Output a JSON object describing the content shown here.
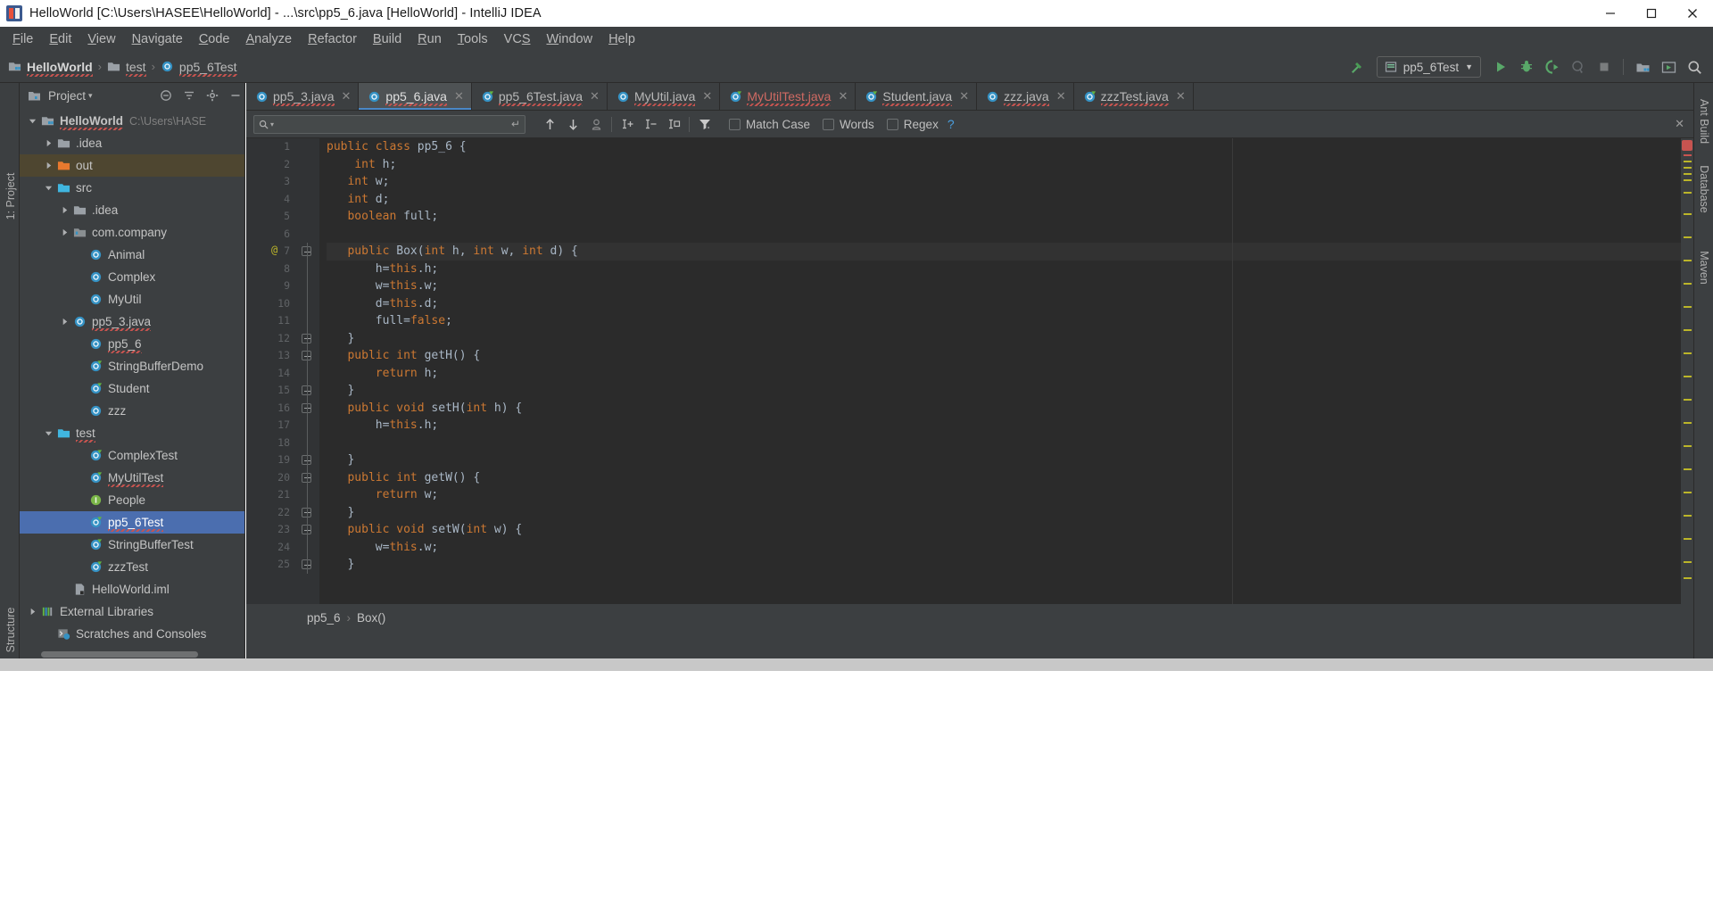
{
  "window": {
    "title": "HelloWorld [C:\\Users\\HASEE\\HelloWorld] - ...\\src\\pp5_6.java [HelloWorld] - IntelliJ IDEA",
    "app_icon": "intellij-idea-icon",
    "minimize_label": "Minimize",
    "maximize_label": "Maximize",
    "close_label": "Close"
  },
  "menubar": {
    "items": [
      {
        "label": "File",
        "mnemonic": "F"
      },
      {
        "label": "Edit",
        "mnemonic": "E"
      },
      {
        "label": "View",
        "mnemonic": "V"
      },
      {
        "label": "Navigate",
        "mnemonic": "N"
      },
      {
        "label": "Code",
        "mnemonic": "C"
      },
      {
        "label": "Analyze",
        "mnemonic": "A"
      },
      {
        "label": "Refactor",
        "mnemonic": "R"
      },
      {
        "label": "Build",
        "mnemonic": "B"
      },
      {
        "label": "Run",
        "mnemonic": "R"
      },
      {
        "label": "Tools",
        "mnemonic": "T"
      },
      {
        "label": "VCS",
        "mnemonic": "S"
      },
      {
        "label": "Window",
        "mnemonic": "W"
      },
      {
        "label": "Help",
        "mnemonic": "H"
      }
    ]
  },
  "navbar": {
    "breadcrumbs": [
      {
        "label": "HelloWorld",
        "icon": "module-icon"
      },
      {
        "label": "test",
        "icon": "folder-icon"
      },
      {
        "label": "pp5_6Test",
        "icon": "java-class-icon"
      }
    ],
    "separator": "›",
    "build_icon": "build-hammer-icon",
    "run_config": {
      "label": "pp5_6Test",
      "icon": "junit-config-icon",
      "chevron": "▼"
    },
    "toolbar_icons": [
      "run-icon",
      "debug-icon",
      "run-with-coverage-icon",
      "profile-icon",
      "stop-icon",
      "project-structure-icon",
      "update-icon",
      "search-everywhere-icon"
    ]
  },
  "tool_windows": {
    "left": [
      {
        "label": "1: Project"
      },
      {
        "label": "Structure"
      }
    ],
    "right": [
      {
        "label": "Ant Build"
      },
      {
        "label": "Database"
      },
      {
        "label": "Maven"
      }
    ]
  },
  "project_panel": {
    "title": "Project",
    "title_chevron": "▾",
    "header_icons": [
      "collapse-all-icon",
      "filter-icon",
      "settings-gear-icon",
      "hide-icon"
    ],
    "tree": [
      {
        "label": "HelloWorld",
        "sub": "C:\\Users\\HASE",
        "icon": "module-icon",
        "twisty": "down",
        "indent": 0,
        "bold": true,
        "state": "normal",
        "error": true
      },
      {
        "label": ".idea",
        "sub": "",
        "icon": "folder-icon",
        "twisty": "right",
        "indent": 1,
        "bold": false,
        "state": "normal",
        "error": false
      },
      {
        "label": "out",
        "sub": "",
        "icon": "folder-orange-icon",
        "twisty": "right",
        "indent": 1,
        "bold": false,
        "state": "highlight",
        "error": false
      },
      {
        "label": "src",
        "sub": "",
        "icon": "folder-source-icon",
        "twisty": "down",
        "indent": 1,
        "bold": false,
        "state": "normal",
        "error": false
      },
      {
        "label": ".idea",
        "sub": "",
        "icon": "folder-icon",
        "twisty": "right",
        "indent": 2,
        "bold": false,
        "state": "normal",
        "error": false
      },
      {
        "label": "com.company",
        "sub": "",
        "icon": "package-icon",
        "twisty": "right",
        "indent": 2,
        "bold": false,
        "state": "normal",
        "error": false
      },
      {
        "label": "Animal",
        "sub": "",
        "icon": "java-class-icon",
        "twisty": "none",
        "indent": 3,
        "bold": false,
        "state": "normal",
        "error": false
      },
      {
        "label": "Complex",
        "sub": "",
        "icon": "java-class-icon",
        "twisty": "none",
        "indent": 3,
        "bold": false,
        "state": "normal",
        "error": false
      },
      {
        "label": "MyUtil",
        "sub": "",
        "icon": "java-class-icon",
        "twisty": "none",
        "indent": 3,
        "bold": false,
        "state": "normal",
        "error": false
      },
      {
        "label": "pp5_3.java",
        "sub": "",
        "icon": "java-class-icon",
        "twisty": "right",
        "indent": 2,
        "bold": false,
        "state": "normal",
        "error": true
      },
      {
        "label": "pp5_6",
        "sub": "",
        "icon": "java-class-icon",
        "twisty": "none",
        "indent": 3,
        "bold": false,
        "state": "normal",
        "error": true
      },
      {
        "label": "StringBufferDemo",
        "sub": "",
        "icon": "java-runnable-icon",
        "twisty": "none",
        "indent": 3,
        "bold": false,
        "state": "normal",
        "error": false
      },
      {
        "label": "Student",
        "sub": "",
        "icon": "java-runnable-icon",
        "twisty": "none",
        "indent": 3,
        "bold": false,
        "state": "normal",
        "error": false
      },
      {
        "label": "zzz",
        "sub": "",
        "icon": "java-class-icon",
        "twisty": "none",
        "indent": 3,
        "bold": false,
        "state": "normal",
        "error": false
      },
      {
        "label": "test",
        "sub": "",
        "icon": "folder-test-icon",
        "twisty": "down",
        "indent": 1,
        "bold": false,
        "state": "normal",
        "error": true
      },
      {
        "label": "ComplexTest",
        "sub": "",
        "icon": "java-runnable-icon",
        "twisty": "none",
        "indent": 3,
        "bold": false,
        "state": "normal",
        "error": false
      },
      {
        "label": "MyUtilTest",
        "sub": "",
        "icon": "java-runnable-icon",
        "twisty": "none",
        "indent": 3,
        "bold": false,
        "state": "normal",
        "error": true
      },
      {
        "label": "People",
        "sub": "",
        "icon": "java-interface-icon",
        "twisty": "none",
        "indent": 3,
        "bold": false,
        "state": "normal",
        "error": false
      },
      {
        "label": "pp5_6Test",
        "sub": "",
        "icon": "java-runnable-icon",
        "twisty": "none",
        "indent": 3,
        "bold": false,
        "state": "selected",
        "error": true
      },
      {
        "label": "StringBufferTest",
        "sub": "",
        "icon": "java-runnable-icon",
        "twisty": "none",
        "indent": 3,
        "bold": false,
        "state": "normal",
        "error": false
      },
      {
        "label": "zzzTest",
        "sub": "",
        "icon": "java-runnable-icon",
        "twisty": "none",
        "indent": 3,
        "bold": false,
        "state": "normal",
        "error": false
      },
      {
        "label": "HelloWorld.iml",
        "sub": "",
        "icon": "iml-file-icon",
        "twisty": "none",
        "indent": 2,
        "bold": false,
        "state": "normal",
        "error": false
      },
      {
        "label": "External Libraries",
        "sub": "",
        "icon": "libraries-icon",
        "twisty": "right",
        "indent": 0,
        "bold": false,
        "state": "normal",
        "error": false
      },
      {
        "label": "Scratches and Consoles",
        "sub": "",
        "icon": "scratches-icon",
        "twisty": "none",
        "indent": 1,
        "bold": false,
        "state": "normal",
        "error": false
      }
    ]
  },
  "editor": {
    "tabs": [
      {
        "label": "pp5_3.java",
        "icon": "java-class-icon",
        "active": false,
        "error": false,
        "closable": true
      },
      {
        "label": "pp5_6.java",
        "icon": "java-class-icon",
        "active": true,
        "error": false,
        "closable": true
      },
      {
        "label": "pp5_6Test.java",
        "icon": "java-runnable-icon",
        "active": false,
        "error": false,
        "closable": true
      },
      {
        "label": "MyUtil.java",
        "icon": "java-class-icon",
        "active": false,
        "error": false,
        "closable": true
      },
      {
        "label": "MyUtilTest.java",
        "icon": "java-runnable-icon",
        "active": false,
        "error": true,
        "closable": true
      },
      {
        "label": "Student.java",
        "icon": "java-runnable-icon",
        "active": false,
        "error": false,
        "closable": true
      },
      {
        "label": "zzz.java",
        "icon": "java-class-icon",
        "active": false,
        "error": false,
        "closable": true
      },
      {
        "label": "zzzTest.java",
        "icon": "java-runnable-icon",
        "active": false,
        "error": false,
        "closable": true
      }
    ],
    "find_bar": {
      "search_value": "",
      "search_placeholder": "",
      "search_icon": "magnifier-icon",
      "history_chevron": "▾",
      "enter_icon": "return-arrow-icon",
      "prev_icon": "arrow-up-icon",
      "next_icon": "arrow-down-icon",
      "select_all_icon": "select-all-occurrences-icon",
      "add_selection_icon": "add-selection-icon",
      "remove_selection_icon": "remove-selection-icon",
      "select_all_carets_icon": "select-all-carets-icon",
      "filter_icon": "filter-funnel-icon",
      "close_icon": "close-icon",
      "checkboxes": [
        {
          "label": "Match Case",
          "mnemonic": "C",
          "checked": false
        },
        {
          "label": "Words",
          "mnemonic": "o",
          "checked": false
        },
        {
          "label": "Regex",
          "mnemonic": "x",
          "checked": false
        }
      ],
      "help_label": "?"
    },
    "code": {
      "start_line": 1,
      "lines": [
        {
          "n": 1,
          "text": "public class pp5_6 {",
          "fold": "none",
          "at": false,
          "hl": false
        },
        {
          "n": 2,
          "text": "    int h;",
          "fold": "none",
          "at": false,
          "hl": false
        },
        {
          "n": 3,
          "text": "   int w;",
          "fold": "none",
          "at": false,
          "hl": false
        },
        {
          "n": 4,
          "text": "   int d;",
          "fold": "none",
          "at": false,
          "hl": false
        },
        {
          "n": 5,
          "text": "   boolean full;",
          "fold": "none",
          "at": false,
          "hl": false
        },
        {
          "n": 6,
          "text": "",
          "fold": "none",
          "at": false,
          "hl": false
        },
        {
          "n": 7,
          "text": "   public Box(int h, int w, int d) {",
          "fold": "start",
          "at": true,
          "hl": true
        },
        {
          "n": 8,
          "text": "       h=this.h;",
          "fold": "body",
          "at": false,
          "hl": false
        },
        {
          "n": 9,
          "text": "       w=this.w;",
          "fold": "body",
          "at": false,
          "hl": false
        },
        {
          "n": 10,
          "text": "       d=this.d;",
          "fold": "body",
          "at": false,
          "hl": false
        },
        {
          "n": 11,
          "text": "       full=false;",
          "fold": "body",
          "at": false,
          "hl": false
        },
        {
          "n": 12,
          "text": "   }",
          "fold": "end",
          "at": false,
          "hl": false
        },
        {
          "n": 13,
          "text": "   public int getH() {",
          "fold": "start",
          "at": false,
          "hl": false
        },
        {
          "n": 14,
          "text": "       return h;",
          "fold": "body",
          "at": false,
          "hl": false
        },
        {
          "n": 15,
          "text": "   }",
          "fold": "end",
          "at": false,
          "hl": false
        },
        {
          "n": 16,
          "text": "   public void setH(int h) {",
          "fold": "start",
          "at": false,
          "hl": false
        },
        {
          "n": 17,
          "text": "       h=this.h;",
          "fold": "body",
          "at": false,
          "hl": false
        },
        {
          "n": 18,
          "text": "",
          "fold": "body",
          "at": false,
          "hl": false
        },
        {
          "n": 19,
          "text": "   }",
          "fold": "end",
          "at": false,
          "hl": false
        },
        {
          "n": 20,
          "text": "   public int getW() {",
          "fold": "start",
          "at": false,
          "hl": false
        },
        {
          "n": 21,
          "text": "       return w;",
          "fold": "body",
          "at": false,
          "hl": false
        },
        {
          "n": 22,
          "text": "   }",
          "fold": "end",
          "at": false,
          "hl": false
        },
        {
          "n": 23,
          "text": "   public void setW(int w) {",
          "fold": "start",
          "at": false,
          "hl": false
        },
        {
          "n": 24,
          "text": "       w=this.w;",
          "fold": "body",
          "at": false,
          "hl": false
        },
        {
          "n": 25,
          "text": "   }",
          "fold": "end",
          "at": false,
          "hl": false
        }
      ],
      "error_count_badge": "",
      "at_symbol": "@"
    },
    "breadcrumbs": [
      {
        "label": "pp5_6"
      },
      {
        "label": "Box()"
      }
    ],
    "breadcrumb_separator": "›"
  }
}
